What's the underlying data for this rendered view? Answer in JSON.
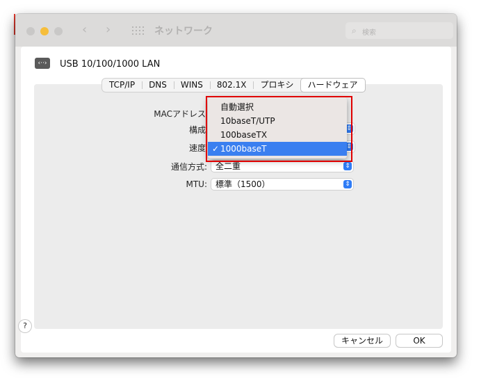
{
  "window": {
    "title": "ネットワーク"
  },
  "search": {
    "placeholder": "検索"
  },
  "device": {
    "name": "USB 10/100/1000 LAN",
    "icon": "ethernet-icon"
  },
  "tabs": [
    {
      "label": "TCP/IP"
    },
    {
      "label": "DNS"
    },
    {
      "label": "WINS"
    },
    {
      "label": "802.1X"
    },
    {
      "label": "プロキシ"
    },
    {
      "label": "ハードウェア",
      "active": true
    }
  ],
  "form": {
    "mac_label": "MACアドレス",
    "config_label": "構成",
    "speed_label": "速度",
    "duplex_label": "通信方式:",
    "duplex_value": "全二重",
    "mtu_label": "MTU:",
    "mtu_value": "標準（1500）"
  },
  "speed_menu": {
    "items": [
      "自動選択",
      "10baseT/UTP",
      "100baseTX",
      "1000baseT"
    ],
    "selected": "1000baseT",
    "check": "✓"
  },
  "footer": {
    "help": "?",
    "cancel": "キャンセル",
    "ok": "OK"
  },
  "colors": {
    "accent": "#2f7cf6",
    "highlight_box": "#e00000",
    "traffic_yellow": "#f6be3b"
  }
}
